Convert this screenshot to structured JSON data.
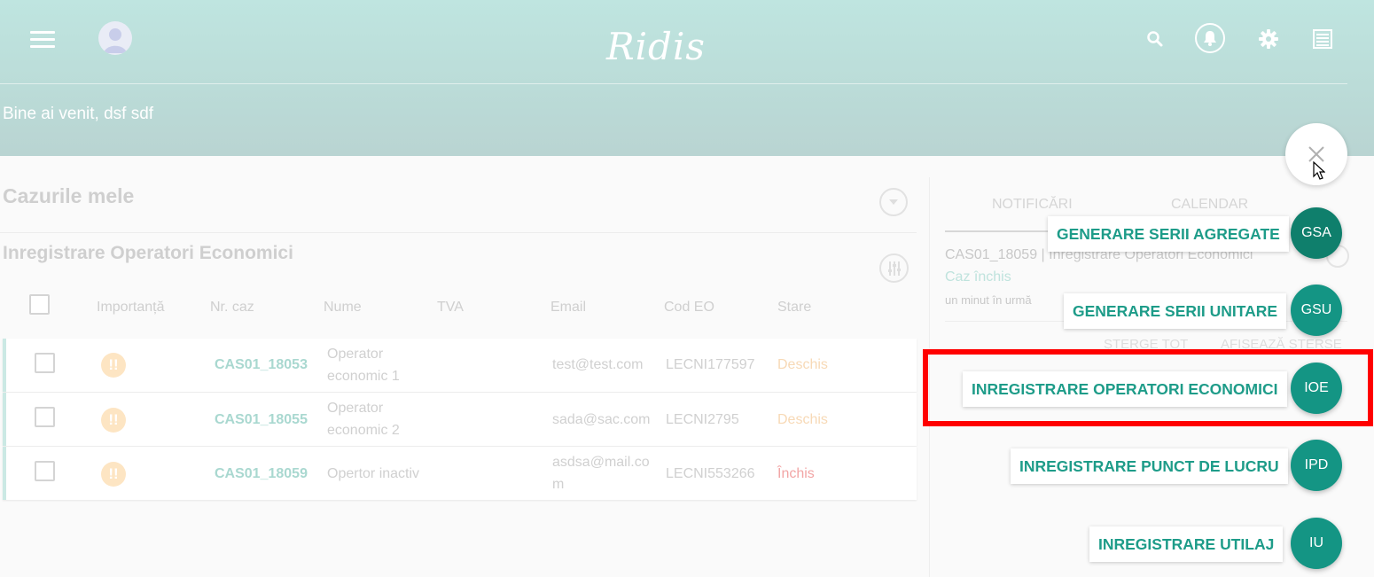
{
  "header": {
    "brand": "Ridis",
    "welcome": "Bine ai venit, dsf sdf"
  },
  "cases": {
    "title": "Cazurile mele",
    "section_title": "Inregistrare Operatori Economici",
    "columns": [
      "Importanță",
      "Nr. caz",
      "Nume",
      "TVA",
      "Email",
      "Cod EO",
      "Stare"
    ],
    "rows": [
      {
        "case": "CAS01_18053",
        "name1": "Operator",
        "name2": "economic 1",
        "email1": "test@test.com",
        "email2": "",
        "code": "LECNI177597",
        "status": "Deschis"
      },
      {
        "case": "CAS01_18055",
        "name1": "Operator",
        "name2": "economic 2",
        "email1": "sada@sac.com",
        "email2": "",
        "code": "LECNI2795",
        "status": "Deschis"
      },
      {
        "case": "CAS01_18059",
        "name1": "Opertor inactiv",
        "name2": "",
        "email1": "asdsa@mail.co",
        "email2": "m",
        "code": "LECNI553266",
        "status": "Închis"
      }
    ],
    "importance_glyph": "!!"
  },
  "right_panel": {
    "tabs": [
      "NOTIFICĂRI",
      "CALENDAR"
    ],
    "notification": {
      "title": "CAS01_18059 | Inregistrare Operatori Economici",
      "status": "Caz închis",
      "time": "un minut în urmă"
    },
    "actions": [
      "ȘTERGE TOT",
      "AFIȘEAZĂ ȘTERSE"
    ]
  },
  "speed_dial": {
    "items": [
      {
        "label": "GENERARE SERII AGREGATE",
        "abbr": "GSA"
      },
      {
        "label": "GENERARE SERII UNITARE",
        "abbr": "GSU"
      },
      {
        "label": "INREGISTRARE OPERATORI ECONOMICI",
        "abbr": "IOE"
      },
      {
        "label": "INREGISTRARE PUNCT DE LUCRU",
        "abbr": "IPD"
      },
      {
        "label": "INREGISTRARE UTILAJ",
        "abbr": "IU"
      }
    ]
  },
  "colors": {
    "accent": "#1e9c89",
    "fab_dark": "#0f7f6c",
    "fab": "#149584",
    "highlight": "#ff0000",
    "status_open": "#f7d9b6",
    "status_closed": "#f2a5a5"
  }
}
